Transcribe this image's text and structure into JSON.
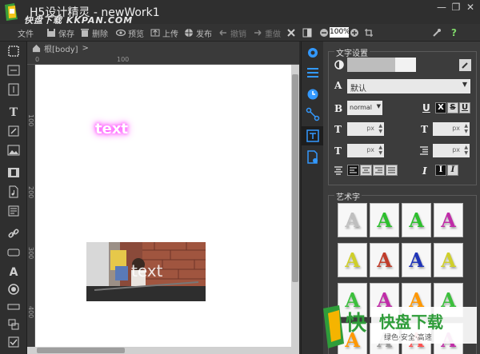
{
  "window": {
    "title": "H5设计精灵 - newWork1",
    "watermark": "快盘下载 KKPAN.COM",
    "controls": {
      "minimize": "—",
      "restore": "❐",
      "close": "✕"
    }
  },
  "toolbar": {
    "file": "文件",
    "save": "保存",
    "delete": "删除",
    "preview": "预览",
    "upload": "上传",
    "publish": "发布",
    "undo": "撤销",
    "redo": "重做",
    "zoom": "100%"
  },
  "breadcrumb": {
    "label": "根[body]",
    "arrow": ">"
  },
  "ruler": {
    "top": [
      "0",
      "100"
    ],
    "left": [
      "100",
      "200",
      "300",
      "400"
    ]
  },
  "canvas": {
    "glow_text": "text",
    "photo_text": "text"
  },
  "panel": {
    "text_section_title": "文字设置",
    "font_family": "默认",
    "font_weight": "normal",
    "unit": "px",
    "art_section_title": "艺术字",
    "art_letter": "A",
    "art_colors": [
      "#bfbfbf",
      "#2dbf2d",
      "#2dbf2d",
      "#c02ca8",
      "#cfcf2a",
      "#c03c2a",
      "#2035b8",
      "#cfcf2a",
      "#3cc03c",
      "#c02ca8",
      "#ff9800",
      "#3cbf3c",
      "#ff9800",
      "#999999",
      "#ff5050",
      "#c02ca8"
    ],
    "style_buttons": {
      "underline": "U",
      "x": "X",
      "s": "S",
      "u2": "U",
      "bold": "B",
      "italic": "I"
    },
    "letters": {
      "a": "A",
      "t": "T"
    }
  },
  "brand": {
    "name": "快盘下载",
    "slogan": "绿色·安全·高速",
    "glyph": "快"
  },
  "colors": {
    "accent": "#3399ff",
    "panel_bg": "#3c3c3c",
    "toolbar_bg": "#333333"
  }
}
